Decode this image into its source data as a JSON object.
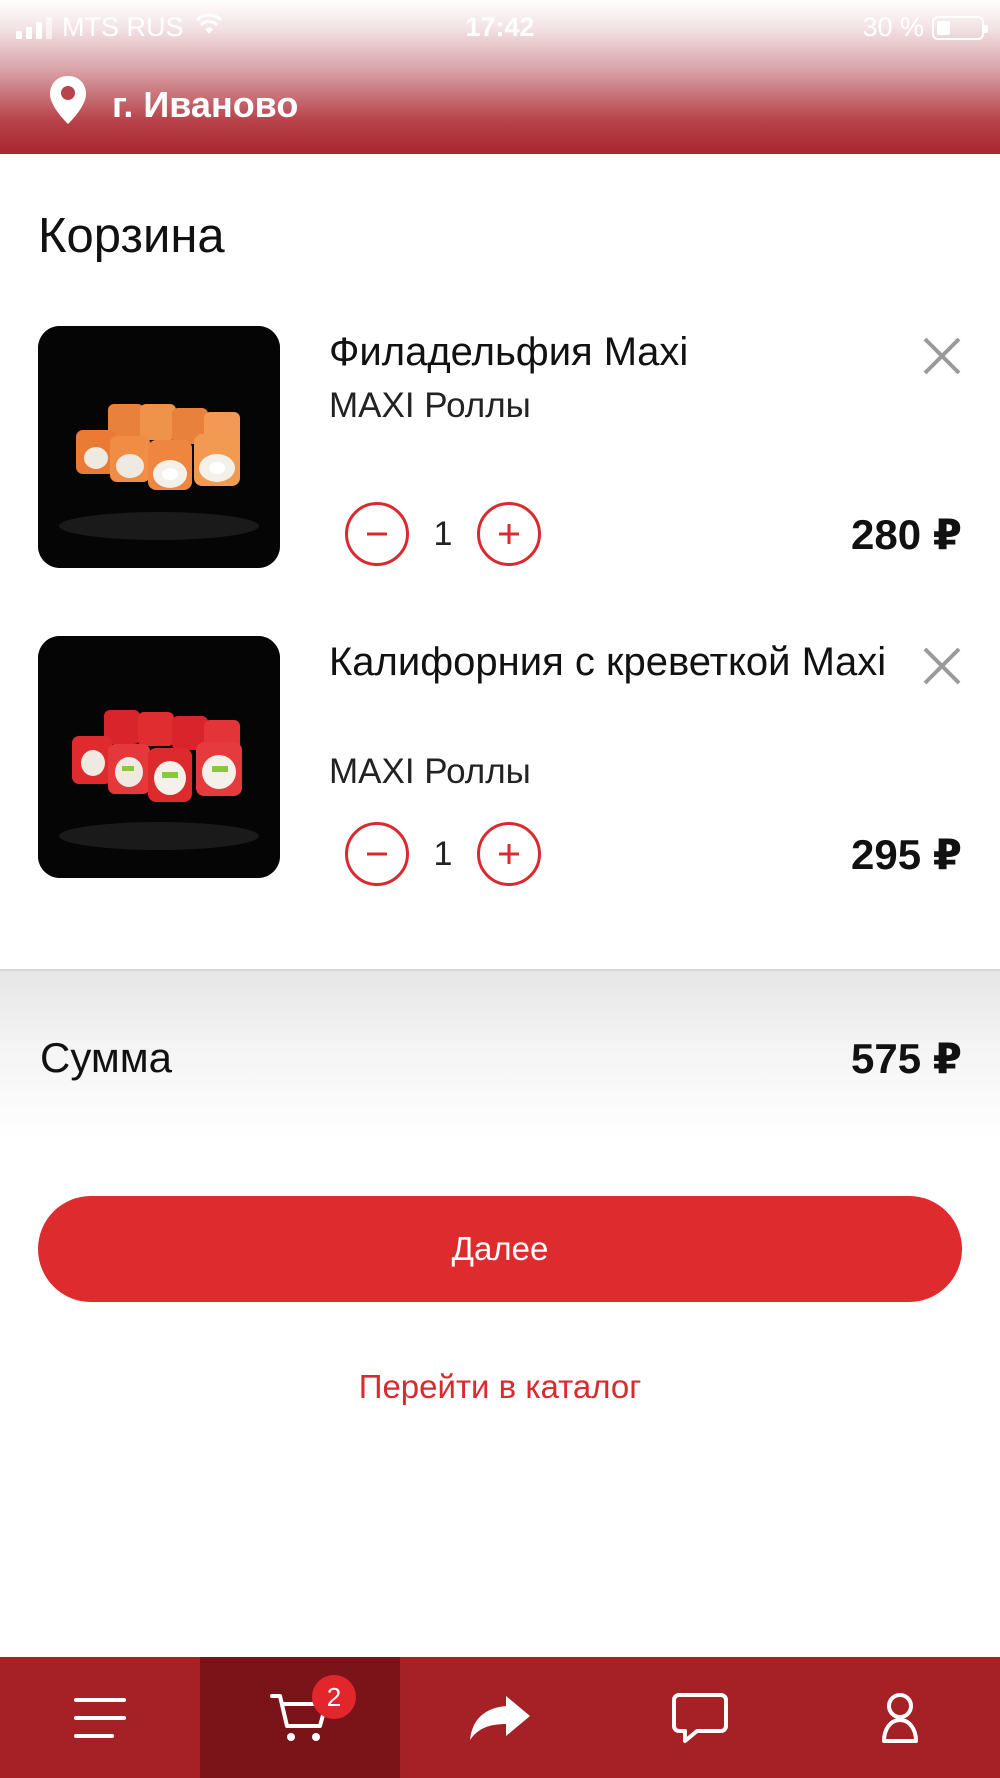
{
  "status_bar": {
    "carrier": "MTS RUS",
    "time": "17:42",
    "battery": "30 %",
    "battery_level": 0.3
  },
  "header": {
    "city": "г. Иваново",
    "location_icon": "location-pin-icon"
  },
  "cart": {
    "title": "Корзина",
    "items": [
      {
        "name": "Филадельфия Maxi",
        "category": "MAXI Роллы",
        "quantity": "1",
        "price": "280 ₽",
        "image": "philadelphia-roll-image"
      },
      {
        "name": "Калифорния с креветкой Maxi",
        "category": "MAXI Роллы",
        "quantity": "1",
        "price": "295 ₽",
        "image": "california-shrimp-roll-image"
      }
    ],
    "sum_label": "Сумма",
    "sum_value": "575 ₽",
    "next_label": "Далее",
    "catalog_link": "Перейти в каталог"
  },
  "tabbar": {
    "tabs": [
      {
        "icon": "menu-icon",
        "active": false
      },
      {
        "icon": "cart-icon",
        "active": true,
        "badge": "2"
      },
      {
        "icon": "share-icon",
        "active": false
      },
      {
        "icon": "chat-icon",
        "active": false
      },
      {
        "icon": "profile-icon",
        "active": false
      }
    ]
  },
  "colors": {
    "accent": "#dd2b2e",
    "header_dark": "#a8262f",
    "tabbar": "#a52126",
    "tabbar_active": "#7a1418"
  }
}
